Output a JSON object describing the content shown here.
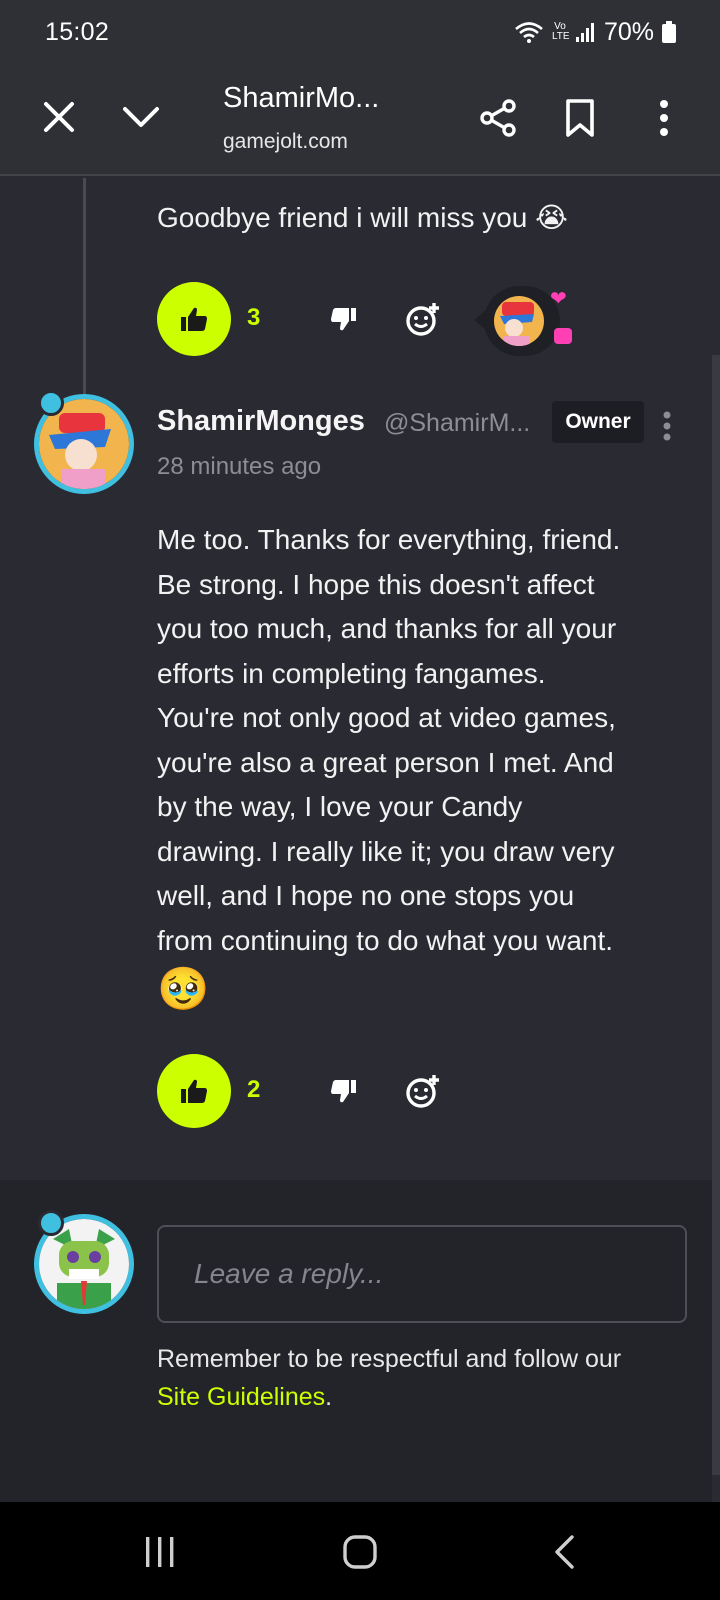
{
  "status_bar": {
    "time": "15:02",
    "volte": "Vo LTE",
    "battery": "70%"
  },
  "toolbar": {
    "title": "ShamirMo...",
    "url": "gamejolt.com"
  },
  "previous_comment": {
    "text": "Goodbye friend i will miss you 😭",
    "likes": "3"
  },
  "comment": {
    "author": "ShamirMonges",
    "handle": "@ShamirM...",
    "badge": "Owner",
    "time": "28 minutes ago",
    "lines": [
      "Me too. Thanks for everything, friend.",
      "Be strong. I hope this doesn't affect",
      "you too much, and thanks for all your",
      "efforts in completing fangames.",
      "You're not only good at video games,",
      "you're also a great person I met. And",
      "by the way, I love your Candy",
      "drawing. I really like it; you draw very",
      "well, and I hope no one stops you",
      "from continuing to do what you want."
    ],
    "emoji": "🥹",
    "likes": "2"
  },
  "reply": {
    "placeholder": "Leave a reply...",
    "notice": "Remember to be respectful and follow our",
    "link_text": "Site Guidelines",
    "period": "."
  },
  "colors": {
    "accent": "#ccff00",
    "background": "#2a2a33",
    "toolbar": "#2f3035",
    "avatar_ring": "#3fc0e0",
    "pink": "#ff3fb4"
  },
  "icons": [
    "wifi-icon",
    "signal-icon",
    "battery-icon",
    "close-icon",
    "chevron-down-icon",
    "share-icon",
    "bookmark-icon",
    "more-vert-icon",
    "thumbs-up-icon",
    "thumbs-down-icon",
    "add-reaction-icon",
    "heart-icon",
    "recents-icon",
    "home-icon",
    "back-icon"
  ]
}
